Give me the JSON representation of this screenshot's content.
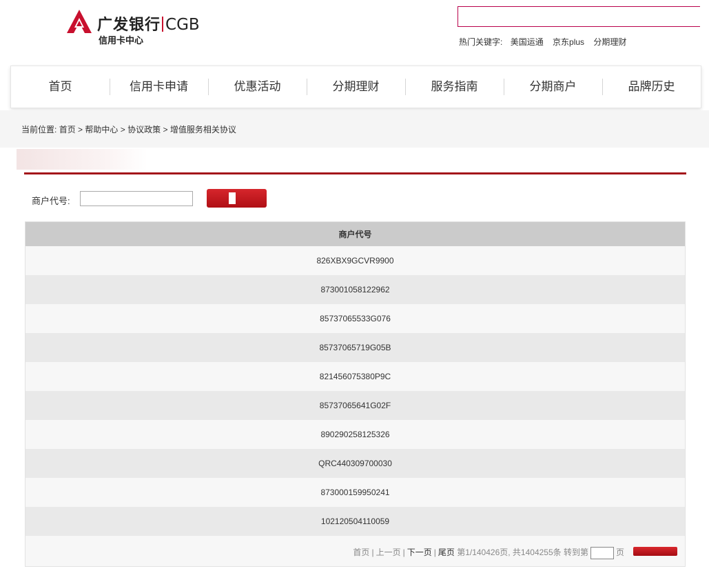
{
  "header": {
    "logo_cn": "广发银行",
    "logo_en": "CGB",
    "logo_sub": "信用卡中心",
    "hot_label": "热门关键字:",
    "hot_keywords": [
      "美国运通",
      "京东plus",
      "分期理财"
    ]
  },
  "nav": {
    "items": [
      "首页",
      "信用卡申请",
      "优惠活动",
      "分期理财",
      "服务指南",
      "分期商户",
      "品牌历史"
    ]
  },
  "breadcrumb": {
    "label": "当前位置:",
    "items": [
      "首页",
      "帮助中心",
      "协议政策",
      "增值服务相关协议"
    ],
    "separator": ">"
  },
  "query": {
    "label": "商户代号:",
    "value": ""
  },
  "table": {
    "header": "商户代号",
    "rows": [
      "826XBX9GCVR9900",
      "873001058122962",
      "85737065533G076",
      "85737065719G05B",
      "821456075380P9C",
      "85737065641G02F",
      "890290258125326",
      "QRC440309700030",
      "873000159950241",
      "102120504110059"
    ]
  },
  "pager": {
    "first": "首页",
    "prev": "上一页",
    "next": "下一页",
    "last": "尾页",
    "info": "第1/140426页, 共1404255条 转到第",
    "suffix": "页",
    "goto_value": ""
  },
  "colors": {
    "brand_red": "#c8102e",
    "divider_red": "#a3141a"
  }
}
